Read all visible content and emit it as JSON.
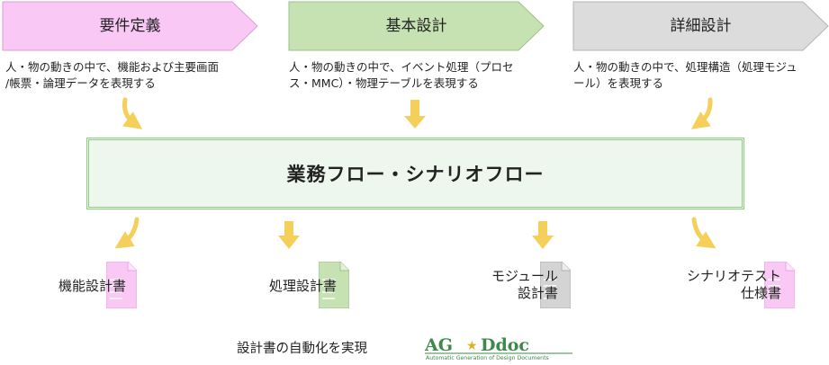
{
  "phases": [
    {
      "label": "要件定義",
      "color": "#f9c8f5",
      "desc_lines": [
        "人・物の動きの中で、機能および主要画面",
        "/帳票・論理データを表現する"
      ]
    },
    {
      "label": "基本設計",
      "color": "#c6e2b3",
      "desc_lines": [
        "人・物の動きの中で、イベント処理（プロセ",
        "ス・MMC）・物理テーブルを表現する"
      ]
    },
    {
      "label": "詳細設計",
      "color": "#dcdcdc",
      "desc_lines": [
        "人・物の動きの中で、処理構造（処理モジュ",
        "ール）を表現する"
      ]
    }
  ],
  "main_flow": {
    "title": "業務フロー・シナリオフロー"
  },
  "documents": [
    {
      "lines": [
        "機能設計書"
      ],
      "color": "#f9c8f5"
    },
    {
      "lines": [
        "処理設計書"
      ],
      "color": "#c6e2b3"
    },
    {
      "lines": [
        "モジュール",
        "設計書"
      ],
      "color": "#d4d4d4"
    },
    {
      "lines": [
        "シナリオテスト",
        "仕様書"
      ],
      "color": "#f9c8f5"
    }
  ],
  "footer": {
    "text": "設計書の自動化を実現"
  },
  "logo": {
    "name": "AG★Ddoc",
    "main": "AG",
    "star": "★",
    "suffix": "Ddoc",
    "tagline": "Automatic Generation of Design Documents",
    "color": "#3c8a4a",
    "star_color": "#e0b020"
  },
  "arrow_color": "#f4cf5a"
}
